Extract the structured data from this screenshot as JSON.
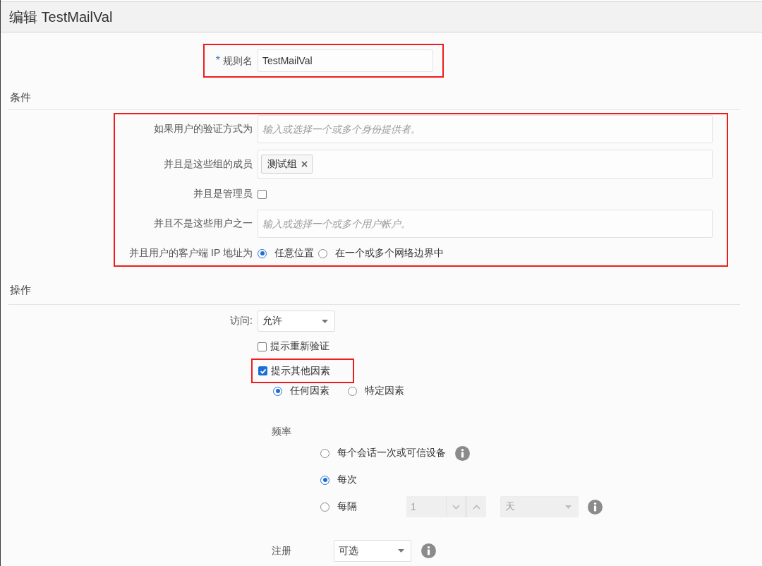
{
  "header": {
    "title": "编辑 TestMailVal"
  },
  "rule_name": {
    "required_mark": "*",
    "label": "规则名",
    "value": "TestMailVal",
    "highlighted": true
  },
  "conditions": {
    "heading": "条件",
    "highlighted": true,
    "rows": [
      {
        "kind": "input",
        "label": "如果用户的验证方式为",
        "placeholder": "输入或选择一个或多个身份提供者。"
      },
      {
        "kind": "tags",
        "label": "并且是这些组的成员",
        "tags": [
          "测试组"
        ]
      },
      {
        "kind": "checkbox",
        "label": "并且是管理员",
        "checked": false
      },
      {
        "kind": "input",
        "label": "并且不是这些用户之一",
        "placeholder": "输入或选择一个或多个用户帐户。"
      },
      {
        "kind": "radios",
        "label": "并且用户的客户端 IP 地址为",
        "options": [
          {
            "label": "任意位置",
            "selected": true
          },
          {
            "label": "在一个或多个网络边界中",
            "selected": false
          }
        ]
      }
    ]
  },
  "actions": {
    "heading": "操作",
    "access": {
      "label": "访问:",
      "value": "允许"
    },
    "reauthenticate": {
      "label": "提示重新验证",
      "checked": false
    },
    "additional_factor": {
      "label": "提示其他因素",
      "checked": true,
      "highlighted": true,
      "options": [
        {
          "label": "任何因素",
          "selected": true
        },
        {
          "label": "特定因素",
          "selected": false
        }
      ]
    },
    "frequency": {
      "label": "频率",
      "options": [
        {
          "kind": "info",
          "label": "每个会话一次或可信设备",
          "selected": false
        },
        {
          "kind": "plain",
          "label": "每次",
          "selected": true
        },
        {
          "kind": "interval",
          "label": "每隔",
          "selected": false,
          "count": {
            "value": "1",
            "disabled": true
          },
          "unit": {
            "value": "天",
            "disabled": true
          }
        }
      ]
    },
    "enrollment": {
      "label": "注册",
      "value": "可选"
    }
  }
}
